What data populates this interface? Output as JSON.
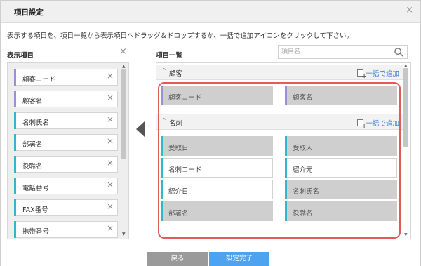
{
  "dialog": {
    "title": "項目設定",
    "close_icon": "×",
    "description": "表示する項目を、項目一覧から表示項目へドラッグ＆ドロップするか、一括で追加アイコンをクリックして下さい。"
  },
  "left": {
    "heading": "表示項目",
    "clear_icon": "×",
    "items": [
      {
        "label": "顧客コード",
        "color": "#9b8fd6"
      },
      {
        "label": "顧客名",
        "color": "#9b8fd6"
      },
      {
        "label": "名刺氏名",
        "color": "#31b7c9"
      },
      {
        "label": "部署名",
        "color": "#31b7c9"
      },
      {
        "label": "役職名",
        "color": "#31b7c9"
      },
      {
        "label": "電話番号",
        "color": "#31b7c9"
      },
      {
        "label": "FAX番号",
        "color": "#31b7c9"
      },
      {
        "label": "携帯番号",
        "color": "#31b7c9"
      }
    ],
    "remove_icon": "×"
  },
  "right": {
    "heading": "項目一覧",
    "search_placeholder": "項目名",
    "groups": [
      {
        "name": "顧客",
        "add_label": "一括で追加",
        "fields": [
          {
            "label": "顧客コード",
            "state": "off",
            "color": "#9b8fd6"
          },
          {
            "label": "顧客名",
            "state": "off",
            "color": "#9b8fd6"
          }
        ]
      },
      {
        "name": "名刺",
        "add_label": "一括で追加",
        "fields": [
          {
            "label": "受取日",
            "state": "off",
            "color": "#31b7c9"
          },
          {
            "label": "受取人",
            "state": "off",
            "color": "#31b7c9"
          },
          {
            "label": "名刺コード",
            "state": "on",
            "color": "#31b7c9"
          },
          {
            "label": "紹介元",
            "state": "on",
            "color": "#31b7c9"
          },
          {
            "label": "紹介日",
            "state": "on",
            "color": "#31b7c9"
          },
          {
            "label": "名刺氏名",
            "state": "off",
            "color": "#31b7c9"
          },
          {
            "label": "部署名",
            "state": "off",
            "color": "#31b7c9"
          },
          {
            "label": "役職名",
            "state": "off",
            "color": "#31b7c9"
          }
        ]
      }
    ]
  },
  "footer": {
    "back_label": "戻る",
    "done_label": "設定完了"
  },
  "colors": {
    "highlight": "#e35a5a",
    "link": "#3a7bd5",
    "primary_button": "#4da3f0",
    "secondary_button": "#9a9a9a"
  }
}
